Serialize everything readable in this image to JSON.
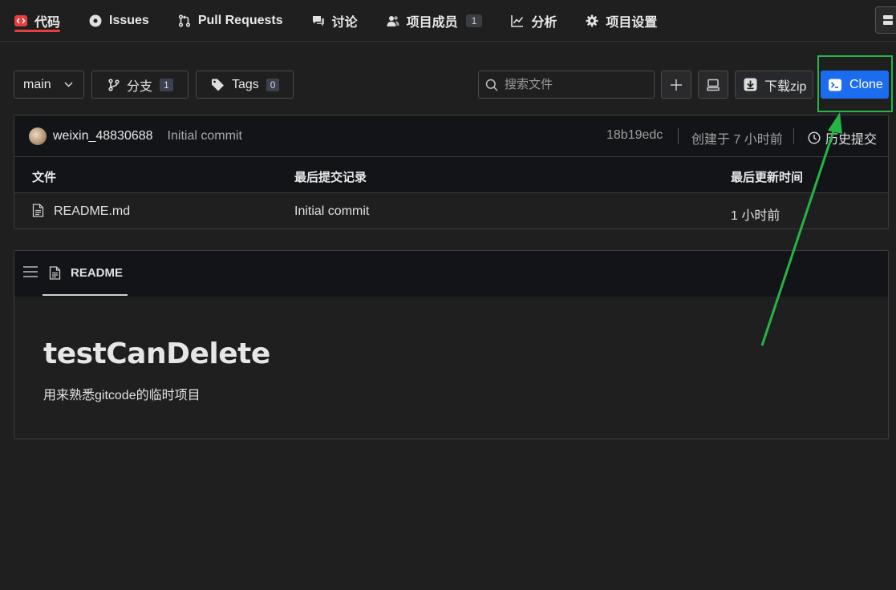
{
  "nav": {
    "tabs": [
      {
        "label": "代码",
        "icon": "code-icon",
        "active": true
      },
      {
        "label": "Issues",
        "icon": "issue-icon"
      },
      {
        "label": "Pull Requests",
        "icon": "pull-request-icon"
      },
      {
        "label": "讨论",
        "icon": "discussion-icon"
      },
      {
        "label": "项目成员",
        "icon": "members-icon",
        "badge": "1"
      },
      {
        "label": "分析",
        "icon": "chart-icon"
      },
      {
        "label": "项目设置",
        "icon": "gear-icon"
      }
    ]
  },
  "toolbar": {
    "branch_select": "main",
    "branches_label": "分支",
    "branches_count": "1",
    "tags_label": "Tags",
    "tags_count": "0",
    "search_placeholder": "搜索文件",
    "download_label": "下载zip",
    "clone_label": "Clone"
  },
  "commit": {
    "author": "weixin_48830688",
    "message": "Initial commit",
    "hash": "18b19edc",
    "time": "创建于 7 小时前",
    "history_label": "历史提交"
  },
  "files": {
    "headers": [
      "文件",
      "最后提交记录",
      "最后更新时间"
    ],
    "rows": [
      {
        "name": "README.md",
        "commit": "Initial commit",
        "updated": "1 小时前"
      }
    ]
  },
  "readme": {
    "tab_label": "README",
    "title": "testCanDelete",
    "description": "用来熟悉gitcode的临时项目"
  },
  "colors": {
    "accent_red": "#e53e3e",
    "clone_blue": "#1c6cf0",
    "annotation_green": "#26b447"
  }
}
